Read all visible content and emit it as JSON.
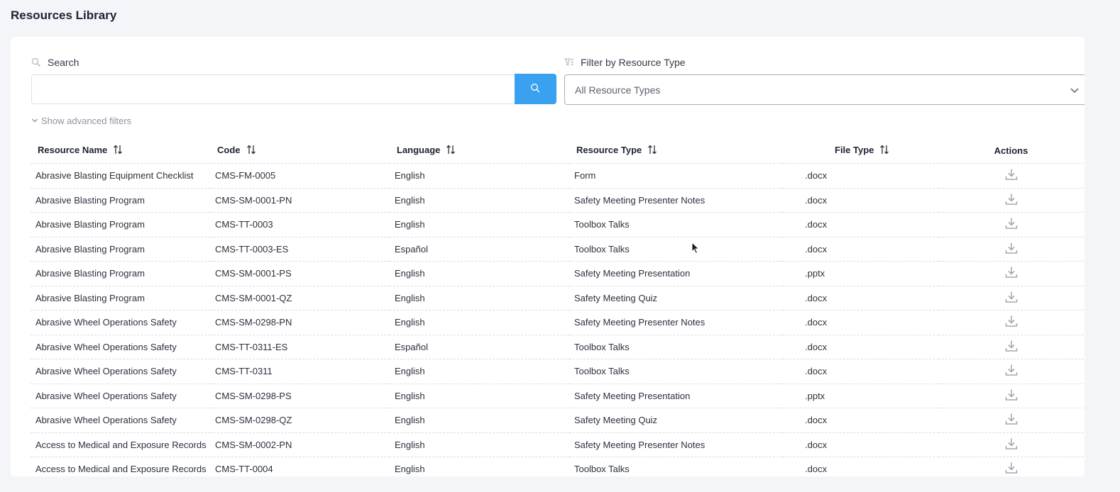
{
  "page": {
    "title": "Resources Library"
  },
  "search": {
    "label": "Search",
    "value": "",
    "placeholder": ""
  },
  "filter": {
    "label": "Filter by Resource Type",
    "selected": "All Resource Types"
  },
  "advanced": {
    "label": "Show advanced filters"
  },
  "icons": {
    "search": "search-icon",
    "filter": "filter-icon",
    "dropdown": "chevron-down-icon",
    "sort": "sort-icon",
    "download": "download-icon"
  },
  "colors": {
    "accent": "#3aa0f0",
    "background": "#f3f5f8"
  },
  "table": {
    "headers": {
      "name": "Resource Name",
      "code": "Code",
      "language": "Language",
      "type": "Resource Type",
      "file": "File Type",
      "actions": "Actions"
    },
    "rows": [
      {
        "name": "Abrasive Blasting Equipment Checklist",
        "code": "CMS-FM-0005",
        "language": "English",
        "type": "Form",
        "file": ".docx"
      },
      {
        "name": "Abrasive Blasting Program",
        "code": "CMS-SM-0001-PN",
        "language": "English",
        "type": "Safety Meeting Presenter Notes",
        "file": ".docx"
      },
      {
        "name": "Abrasive Blasting Program",
        "code": "CMS-TT-0003",
        "language": "English",
        "type": "Toolbox Talks",
        "file": ".docx"
      },
      {
        "name": "Abrasive Blasting Program",
        "code": "CMS-TT-0003-ES",
        "language": "Español",
        "type": "Toolbox Talks",
        "file": ".docx"
      },
      {
        "name": "Abrasive Blasting Program",
        "code": "CMS-SM-0001-PS",
        "language": "English",
        "type": "Safety Meeting Presentation",
        "file": ".pptx"
      },
      {
        "name": "Abrasive Blasting Program",
        "code": "CMS-SM-0001-QZ",
        "language": "English",
        "type": "Safety Meeting Quiz",
        "file": ".docx"
      },
      {
        "name": "Abrasive Wheel Operations Safety",
        "code": "CMS-SM-0298-PN",
        "language": "English",
        "type": "Safety Meeting Presenter Notes",
        "file": ".docx"
      },
      {
        "name": "Abrasive Wheel Operations Safety",
        "code": "CMS-TT-0311-ES",
        "language": "Español",
        "type": "Toolbox Talks",
        "file": ".docx"
      },
      {
        "name": "Abrasive Wheel Operations Safety",
        "code": "CMS-TT-0311",
        "language": "English",
        "type": "Toolbox Talks",
        "file": ".docx"
      },
      {
        "name": "Abrasive Wheel Operations Safety",
        "code": "CMS-SM-0298-PS",
        "language": "English",
        "type": "Safety Meeting Presentation",
        "file": ".pptx"
      },
      {
        "name": "Abrasive Wheel Operations Safety",
        "code": "CMS-SM-0298-QZ",
        "language": "English",
        "type": "Safety Meeting Quiz",
        "file": ".docx"
      },
      {
        "name": "Access to Medical and Exposure Records",
        "code": "CMS-SM-0002-PN",
        "language": "English",
        "type": "Safety Meeting Presenter Notes",
        "file": ".docx"
      },
      {
        "name": "Access to Medical and Exposure Records",
        "code": "CMS-TT-0004",
        "language": "English",
        "type": "Toolbox Talks",
        "file": ".docx"
      }
    ]
  }
}
